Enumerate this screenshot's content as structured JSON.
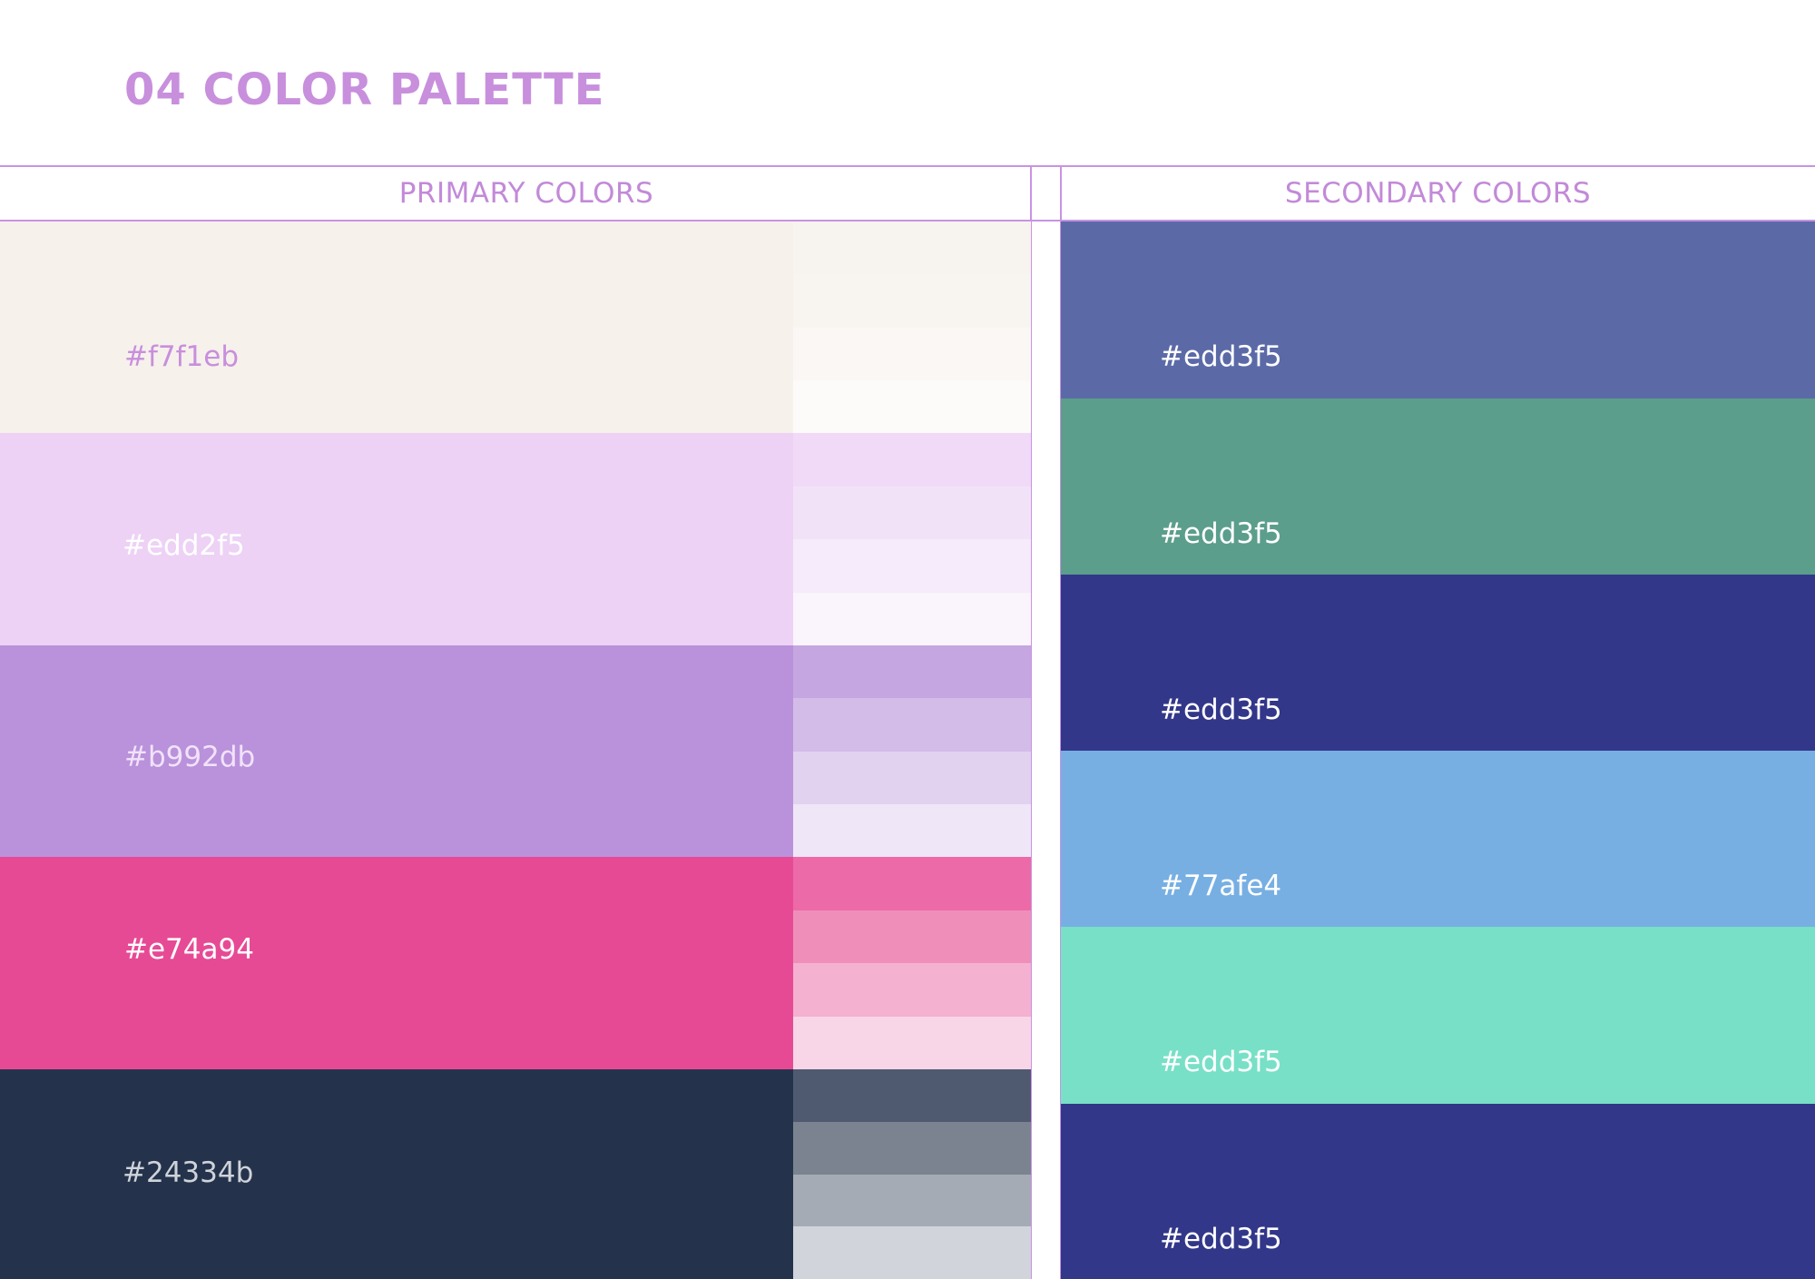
{
  "page": {
    "title": "04 COLOR PALETTE"
  },
  "primary": {
    "heading": "PRIMARY COLORS",
    "swatches": [
      {
        "hex_label": "#f7f1eb",
        "color": "#f6f1eb",
        "label_color": "#c88fdd",
        "tints": [
          "#f7f3ee",
          "#f8f5f1",
          "#faf7f4",
          "#fcfbf9"
        ]
      },
      {
        "hex_label": "#edd2f5",
        "color": "#edd2f5",
        "label_color": "#ffffff",
        "tints": [
          "#f0daf7",
          "#f2e2f8",
          "#f6ebfa",
          "#faf4fc"
        ]
      },
      {
        "hex_label": "#b992db",
        "color": "#b992db",
        "label_color": "#f1e2f9",
        "tints": [
          "#c6a6e1",
          "#d4bce9",
          "#e1d2f0",
          "#efe6f7"
        ]
      },
      {
        "hex_label": "#e74a94",
        "color": "#e74a94",
        "label_color": "#ffffff",
        "tints": [
          "#ec6aa7",
          "#f08eba",
          "#f4b1d0",
          "#f9d6e7"
        ]
      },
      {
        "hex_label": "#24334b",
        "color": "#24334b",
        "label_color": "#cfd3da",
        "tints": [
          "#4f5a70",
          "#7b8391",
          "#a5abb5",
          "#d1d4da"
        ]
      }
    ]
  },
  "secondary": {
    "heading": "SECONDARY COLORS",
    "swatches": [
      {
        "hex_label": "#edd3f5",
        "color": "#5b6aa7"
      },
      {
        "hex_label": "#edd3f5",
        "color": "#5b9e8b"
      },
      {
        "hex_label": "#edd3f5",
        "color": "#323789"
      },
      {
        "hex_label": "#77afe4",
        "color": "#77afe3"
      },
      {
        "hex_label": "#edd3f5",
        "color": "#78e0c7"
      },
      {
        "hex_label": "#edd3f5",
        "color": "#323789"
      }
    ]
  }
}
